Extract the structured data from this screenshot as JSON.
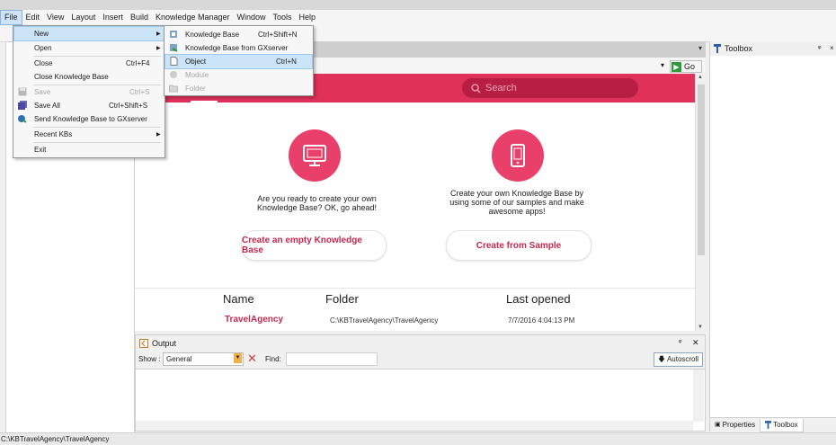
{
  "menubar": {
    "items": [
      "File",
      "Edit",
      "View",
      "Layout",
      "Insert",
      "Build",
      "Knowledge Manager",
      "Window",
      "Tools",
      "Help"
    ]
  },
  "file_menu": {
    "items": [
      {
        "label": "New",
        "shortcut": "",
        "submenu": true,
        "highlighted": true
      },
      {
        "label": "Open",
        "shortcut": "",
        "submenu": true
      },
      {
        "label": "Close",
        "shortcut": "Ctrl+F4"
      },
      {
        "label": "Close Knowledge Base",
        "shortcut": ""
      },
      {
        "label": "Save",
        "shortcut": "Ctrl+S",
        "disabled": true
      },
      {
        "label": "Save All",
        "shortcut": "Ctrl+Shift+S"
      },
      {
        "label": "Send Knowledge Base to GXserver",
        "shortcut": ""
      },
      {
        "label": "Recent KBs",
        "shortcut": "",
        "submenu": true
      },
      {
        "label": "Exit",
        "shortcut": ""
      }
    ]
  },
  "new_menu": {
    "items": [
      {
        "label": "Knowledge Base",
        "shortcut": "Ctrl+Shift+N"
      },
      {
        "label": "Knowledge Base from GXserver",
        "shortcut": ""
      },
      {
        "label": "Object",
        "shortcut": "Ctrl+N",
        "highlighted": true
      },
      {
        "label": "Module",
        "shortcut": "",
        "disabled": true
      },
      {
        "label": "Folder",
        "shortcut": "",
        "disabled": true
      }
    ]
  },
  "address_bar": {
    "go_label": "Go"
  },
  "start_page": {
    "search_placeholder": "Search",
    "create_text": "Are you ready to create your own Knowledge Base? OK, go ahead!",
    "sample_text": "Create your own Knowledge Base by using some of our samples and make awesome apps!",
    "create_button": "Create an empty Knowledge Base",
    "sample_button": "Create from Sample",
    "table": {
      "headers": [
        "Name",
        "Folder",
        "Last opened"
      ],
      "rows": [
        {
          "name": "TravelAgency",
          "folder": "C:\\KBTravelAgency\\TravelAgency",
          "last_opened": "7/7/2016 4:04:13 PM"
        }
      ]
    }
  },
  "output_panel": {
    "title": "Output",
    "show_label": "Show :",
    "show_value": "General",
    "find_label": "Find:",
    "autoscroll_label": "Autoscroll"
  },
  "toolbox_panel": {
    "title": "Toolbox",
    "bottom_tabs": [
      "Properties",
      "Toolbox"
    ]
  },
  "status_bar": {
    "text": "C:\\KBTravelAgency\\TravelAgency"
  },
  "colors": {
    "accent": "#e0315b",
    "accent_dark": "#b81e44",
    "link": "#c42a4f",
    "highlight": "#cce4f7"
  }
}
